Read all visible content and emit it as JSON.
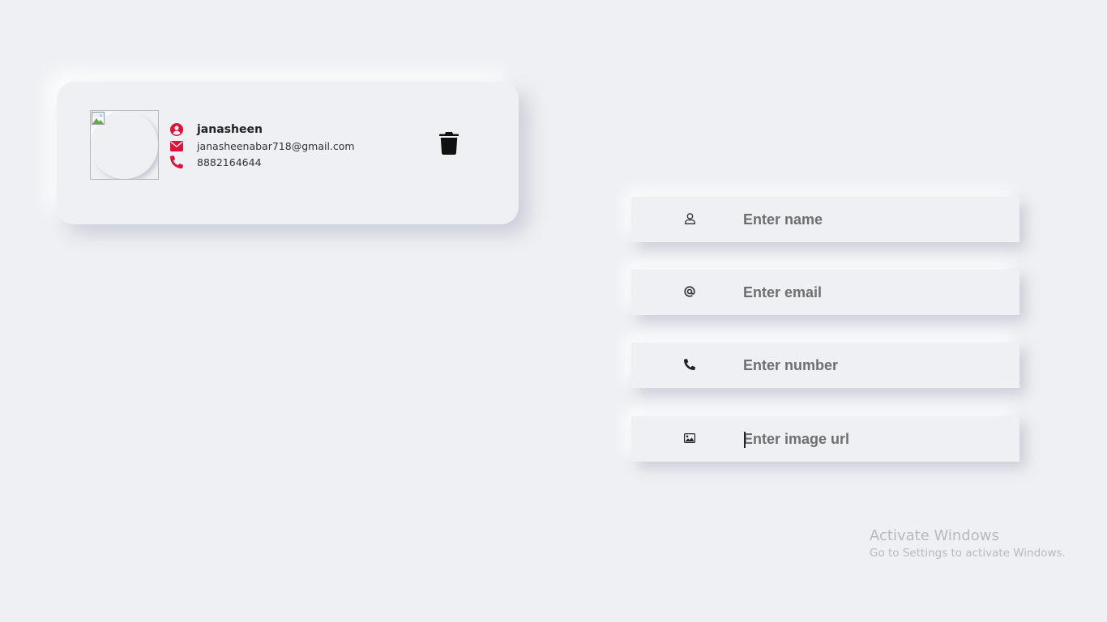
{
  "contact": {
    "name": "janasheen",
    "email": "janasheenabar718@gmail.com",
    "phone": "8882164644",
    "icons": {
      "name": "user-circle-icon",
      "email": "envelope-icon",
      "phone": "phone-icon",
      "delete": "trash-icon"
    },
    "icon_color": "#dc143c"
  },
  "form": {
    "name": {
      "placeholder": "Enter name",
      "icon": "user-icon"
    },
    "email": {
      "placeholder": "Enter email",
      "icon": "at-icon"
    },
    "number": {
      "placeholder": "Enter number",
      "icon": "phone-icon"
    },
    "image_url": {
      "placeholder": "Enter image url",
      "icon": "image-icon"
    }
  },
  "watermark": {
    "title": "Activate Windows",
    "subtitle": "Go to Settings to activate Windows."
  }
}
